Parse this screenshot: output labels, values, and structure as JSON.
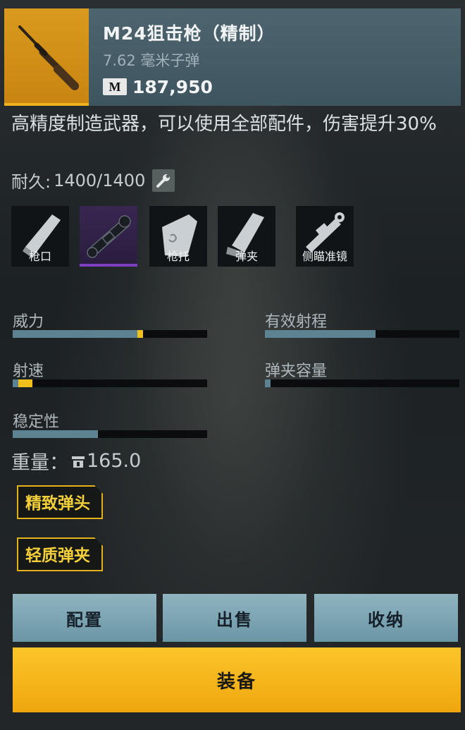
{
  "weapon": {
    "name": "M24狙击枪（精制）",
    "ammo": "7.62 毫米子弹",
    "price": "187,950",
    "currency_icon": "M"
  },
  "description": "高精度制造武器，可以使用全部配件，伤害提升30%",
  "durability": {
    "label": "耐久:",
    "value": "1400/1400"
  },
  "attachments": [
    {
      "label": "枪口",
      "icon": "muzzle-icon",
      "equipped": false
    },
    {
      "label": "",
      "icon": "scope-icon",
      "equipped": true
    },
    {
      "label": "枪托",
      "icon": "stock-icon",
      "equipped": false
    },
    {
      "label": "弹夹",
      "icon": "magazine-icon",
      "equipped": false
    },
    {
      "label": "侧瞄准镜",
      "icon": "side-scope-icon",
      "equipped": false
    }
  ],
  "stats": [
    {
      "label": "威力",
      "base": 0.64,
      "bonus": 0.032
    },
    {
      "label": "有效射程",
      "base": 0.57,
      "bonus": 0
    },
    {
      "label": "射速",
      "base": 0.03,
      "bonus": 0.07
    },
    {
      "label": "弹夹容量",
      "base": 0.03,
      "bonus": 0
    },
    {
      "label": "稳定性",
      "base": 0.44,
      "bonus": 0
    }
  ],
  "weight": {
    "label": "重量：",
    "value": "165.0"
  },
  "tags": [
    "精致弹头",
    "轻质弹夹"
  ],
  "buttons": {
    "config": "配置",
    "sell": "出售",
    "store": "收纳",
    "equip": "装备"
  },
  "colors": {
    "accent": "#f2c01a",
    "bar_fill": "#5d8392",
    "rare_purple": "#7b3fc0",
    "button": "#7fa8b6"
  }
}
